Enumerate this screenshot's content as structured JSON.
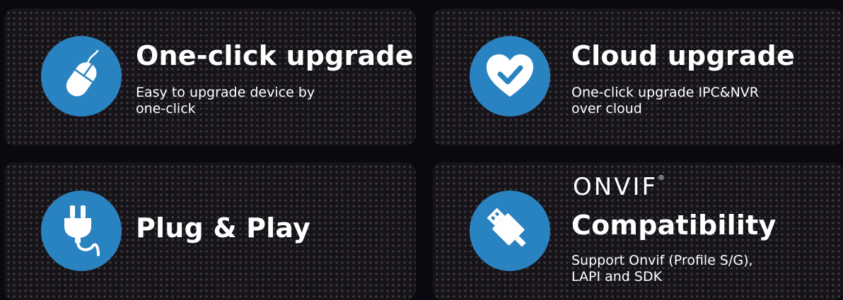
{
  "features": [
    {
      "title": "One-click upgrade",
      "icon": "mouse-icon",
      "description": [
        "Easy to upgrade device by",
        "one-click"
      ]
    },
    {
      "title": "Cloud upgrade",
      "icon": "heart-check-icon",
      "description": [
        "One-click  upgrade  IPC&NVR",
        "over cloud"
      ]
    },
    {
      "title": "Plug & Play",
      "icon": "plug-icon",
      "description": []
    },
    {
      "logo_text": "ONVIF",
      "logo_mark": "®",
      "title": "Compatibility",
      "icon": "usb-icon",
      "description": [
        "Support  Onvif  (Profile S/G),",
        "LAPI and SDK"
      ]
    }
  ],
  "colors": {
    "background": "#0b0910",
    "card": "#171419",
    "dot": "#3e3b41",
    "accent": "#2a83c1",
    "text": "#ffffff"
  }
}
